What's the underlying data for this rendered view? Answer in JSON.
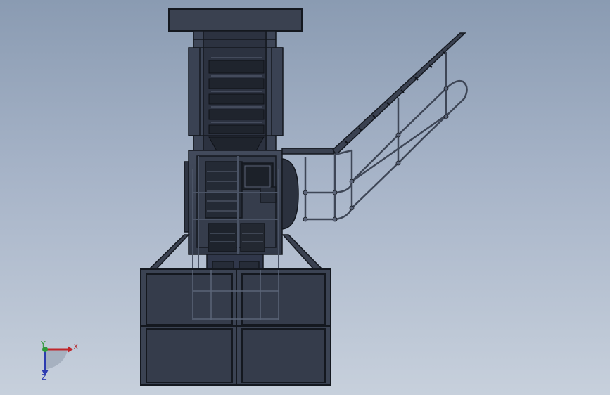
{
  "viewport": {
    "background_top": "#8a9bb2",
    "background_bottom": "#c7d0dc",
    "body_color": "#3b4353",
    "edge_color": "#14181f",
    "highlight_color": "#5b6478"
  },
  "triad": {
    "x_label": "X",
    "y_label": "Y",
    "z_label": "Z",
    "x_color": "#c0262b",
    "y_color": "#2f9a3a",
    "z_color": "#2c3bb0"
  }
}
